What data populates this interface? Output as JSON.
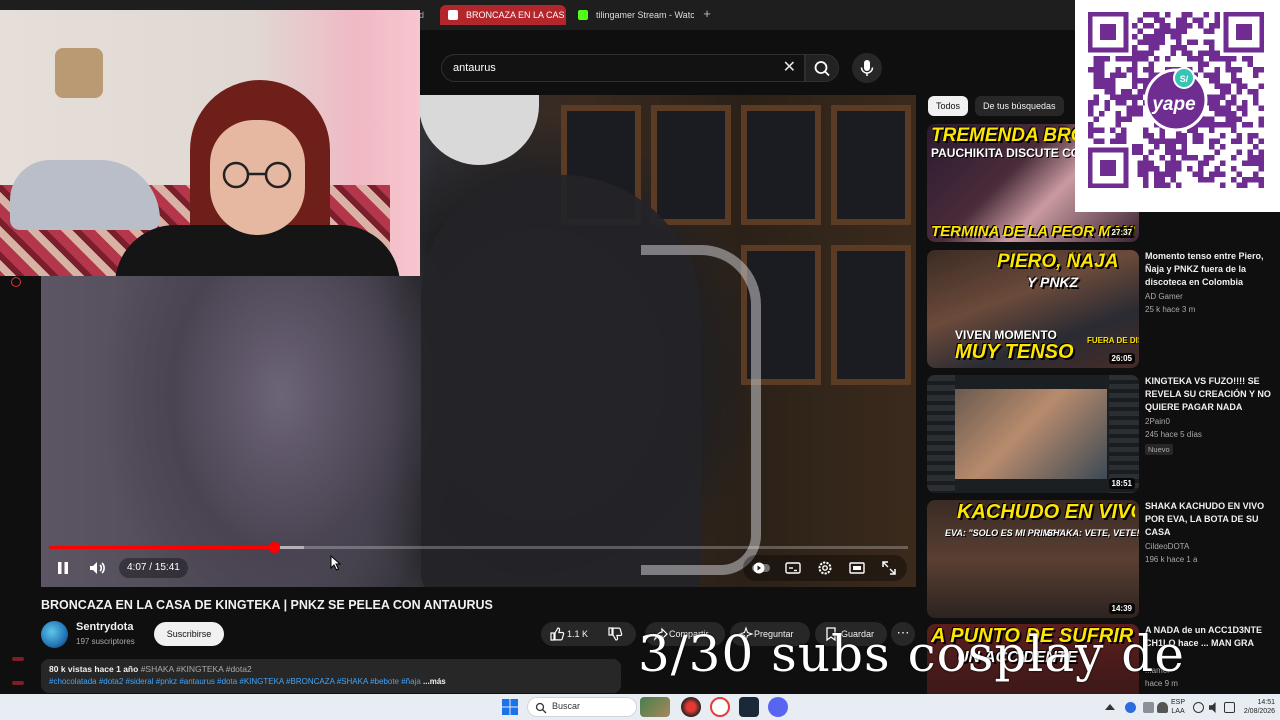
{
  "browser": {
    "tabs": [
      {
        "label": "rd",
        "state": "partial"
      },
      {
        "label": "BRONCAZA EN LA CAS",
        "state": "active",
        "icon": "audio-playing-icon"
      },
      {
        "label": "tilingamer Stream - Watch",
        "state": "inactive",
        "icon": "kick-icon"
      }
    ],
    "new_tab_label": "+"
  },
  "search": {
    "value": "antaurus",
    "clear_label": "✕"
  },
  "player": {
    "time": "4:07 / 15:41",
    "progress_fraction": 0.262,
    "buffered_fraction": 0.297,
    "state": "playing"
  },
  "video": {
    "title": "BRONCAZA EN LA CASA DE KINGTEKA | PNKZ SE PELEA CON ANTAURUS",
    "channel": "Sentrydota",
    "subscribers": "197 suscriptores",
    "subscribe_label": "Suscribirse",
    "likes": "1.1 K",
    "share_label": "Compartir",
    "ask_label": "Preguntar",
    "save_label": "Guardar",
    "more_label": "⋯",
    "views_age": "80 k vistas  hace 1 año",
    "hashtags_top": "#SHAKA #KINGTEKA #dota2",
    "hashtags_line": "#chocolatada #dota2 #sideral #pnkz #antaurus #dota #KINGTEKA #BRONCAZA #SHAKA #bebote #ñaja",
    "more_text": "...más"
  },
  "chips": [
    {
      "label": "Todos",
      "selected": true
    },
    {
      "label": "De tus búsquedas",
      "selected": false
    }
  ],
  "recommendations": [
    {
      "thumb_lines": [
        "TREMENDA BRON",
        "PAUCHIKITA DISCUTE CON",
        "TERMINA DE LA PEOR MANER"
      ],
      "duration": "27:37",
      "title": "",
      "channel": "",
      "stats": ""
    },
    {
      "thumb_lines": [
        "PIERO, ÑAJA",
        "Y PNKZ",
        "VIVEN MOMENTO",
        "MUY TENSO",
        "FUERA DE DISCO"
      ],
      "duration": "26:05",
      "title": "Momento tenso entre Piero, Ñaja y PNKZ fuera de la discoteca en Colombia",
      "channel": "AD Gamer",
      "stats": "25 k  hace 3 m"
    },
    {
      "thumb_lines": [],
      "duration": "18:51",
      "title": "KINGTEKA VS FUZO!!!! SE REVELA SU CREACIÓN Y NO QUIERE PAGAR NADA",
      "channel": "2Pain0",
      "stats": "245  hace 5 días",
      "badge": "Nuevo"
    },
    {
      "thumb_lines": [
        "KACHUDO EN VIVO!!",
        "EVA: \"SOLO ES MI PRIMO\"",
        "SHAKA: VETE, VETE!!"
      ],
      "duration": "14:39",
      "title": "SHAKA KACHUDO EN VIVO POR EVA, LA BOTA DE SU CASA",
      "channel": "CildeoDOTA",
      "stats": "196 k  hace 1 a"
    },
    {
      "thumb_lines": [
        "A PUNTO DE SUFRIR",
        "UN ACCIDENTE"
      ],
      "duration": "",
      "title": "A NADA de un ACC1D3NTE CH1LO hace ... MAN GRA",
      "channel": "...amer",
      "stats": "hace 9 m"
    }
  ],
  "qr": {
    "brand": "yape",
    "badge": "S/"
  },
  "overlay": {
    "text": "3/30 subs cosplay de"
  },
  "taskbar": {
    "search_label": "Buscar",
    "lang_line1": "ESP",
    "lang_line2": "LAA",
    "time": "14:51",
    "date": "2/08/2026"
  },
  "colors": {
    "accent": "#ff0000",
    "active_tab": "#b3262b",
    "thumb_text": "#ffe600",
    "link": "#3ea6ff",
    "qr_purple": "#6f2c91"
  }
}
